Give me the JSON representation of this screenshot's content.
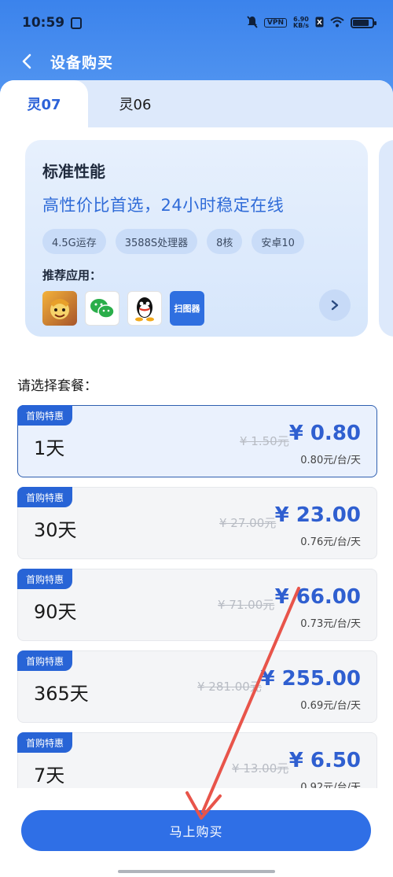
{
  "status": {
    "time": "10:59",
    "vpn": "VPN",
    "speed_value": "6.90",
    "speed_unit": "KB/s"
  },
  "header": {
    "back_icon": "chevron-left-icon",
    "title": "设备购买"
  },
  "tabs": [
    {
      "label": "灵07",
      "active": true
    },
    {
      "label": "灵06",
      "active": false
    }
  ],
  "device": {
    "title": "标准性能",
    "subtitle": "高性价比首选，24小时稳定在线",
    "chips": [
      "4.5G运存",
      "3588S处理器",
      "8核",
      "安卓10"
    ],
    "recommended_label": "推荐应用：",
    "apps": [
      "clash-of-clans-app-icon",
      "wechat-app-icon",
      "qq-app-icon",
      "scanner-app-icon"
    ],
    "scanner_app_text": "扫图器",
    "next_icon": "chevron-right-icon"
  },
  "choose_label": "请选择套餐：",
  "plans": [
    {
      "badge": "首购特惠",
      "name": "1天",
      "original": "¥ 1.50元",
      "price": "¥ 0.80",
      "unit_price": "0.80元/台/天",
      "selected": true
    },
    {
      "badge": "首购特惠",
      "name": "30天",
      "original": "¥ 27.00元",
      "price": "¥ 23.00",
      "unit_price": "0.76元/台/天",
      "selected": false
    },
    {
      "badge": "首购特惠",
      "name": "90天",
      "original": "¥ 71.00元",
      "price": "¥ 66.00",
      "unit_price": "0.73元/台/天",
      "selected": false
    },
    {
      "badge": "首购特惠",
      "name": "365天",
      "original": "¥ 281.00元",
      "price": "¥ 255.00",
      "unit_price": "0.69元/台/天",
      "selected": false
    },
    {
      "badge": "首购特惠",
      "name": "7天",
      "original": "¥ 13.00元",
      "price": "¥ 6.50",
      "unit_price": "0.92元/台/天",
      "selected": false
    }
  ],
  "buy_button": "马上购买",
  "colors": {
    "accent": "#2f6fe6",
    "annotation_arrow": "#e8544a"
  }
}
